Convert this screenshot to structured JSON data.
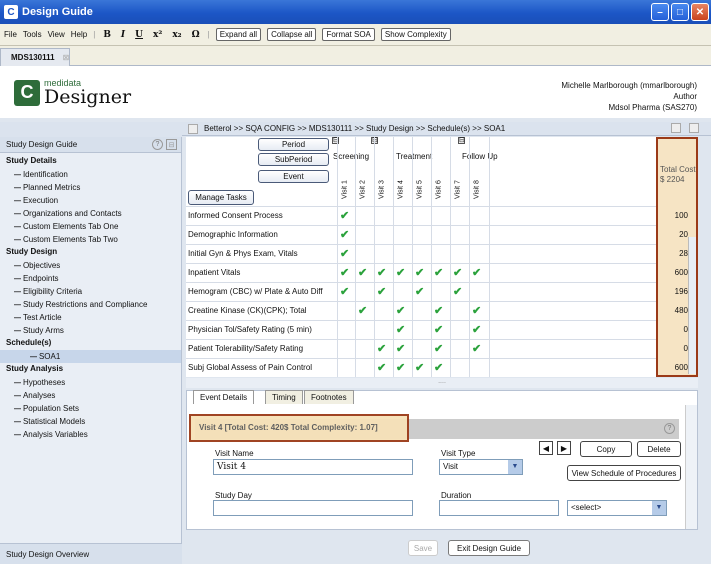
{
  "window": {
    "title": "Design Guide"
  },
  "menu": {
    "items": [
      "File",
      "Tools",
      "View",
      "Help"
    ],
    "format": [
      "B",
      "I",
      "U",
      "x²",
      "x₂",
      "Ω"
    ],
    "buttons": [
      "Expand all",
      "Collapse all",
      "Format SOA",
      "Show Complexity"
    ]
  },
  "doc_tab": "MDS130111",
  "header": {
    "logo_small": "medidata",
    "logo_big": "Designer",
    "user_line1": "Michelle Marlborough (mmarlborough)",
    "user_line2": "Author",
    "user_line3": "Mdsol Pharma (SAS270)"
  },
  "breadcrumb": "Betterol  >>  SQA CONFIG  >>  MDS130111  >>  Study Design  >>  Schedule(s)  >>  SOA1",
  "sidebar": {
    "title": "Study Design Guide",
    "footer": "Study Design Overview",
    "sections": [
      {
        "title": "Study Details",
        "items": [
          "Identification",
          "Planned Metrics",
          "Execution",
          "Organizations and Contacts",
          "Custom Elements Tab One",
          "Custom Elements Tab Two"
        ]
      },
      {
        "title": "Study Design",
        "items": [
          "Objectives",
          "Endpoints",
          "Eligibility Criteria",
          "Study Restrictions and Compliance",
          "Test Article",
          "Study Arms"
        ]
      },
      {
        "title": "Schedule(s)",
        "items": [
          "SOA1"
        ]
      },
      {
        "title": "Study Analysis",
        "items": [
          "Hypotheses",
          "Analyses",
          "Population Sets",
          "Statistical Models",
          "Analysis Variables"
        ]
      }
    ]
  },
  "grid": {
    "buttons": {
      "period": "Period",
      "subperiod": "SubPeriod",
      "event": "Event",
      "manage": "Manage Tasks"
    },
    "phases": [
      "Screening",
      "Treatment",
      "Follow Up"
    ],
    "visits": [
      "Visit 1",
      "Visit 2",
      "Visit 3",
      "Visit 4",
      "Visit 5",
      "Visit 6",
      "Visit 7",
      "Visit 8"
    ],
    "rows": [
      {
        "label": "Informed Consent Process",
        "checks": [
          1,
          0,
          0,
          0,
          0,
          0,
          0,
          0
        ],
        "cost": "100"
      },
      {
        "label": "Demographic Information",
        "checks": [
          1,
          0,
          0,
          0,
          0,
          0,
          0,
          0
        ],
        "cost": "20"
      },
      {
        "label": "Initial Gyn & Phys Exam, Vitals",
        "checks": [
          1,
          0,
          0,
          0,
          0,
          0,
          0,
          0
        ],
        "cost": "28"
      },
      {
        "label": "Inpatient Vitals",
        "checks": [
          1,
          1,
          1,
          1,
          1,
          1,
          1,
          1
        ],
        "cost": "600"
      },
      {
        "label": "Hemogram (CBC) w/ Plate & Auto Diff",
        "checks": [
          1,
          0,
          1,
          0,
          1,
          0,
          1,
          0
        ],
        "cost": "196"
      },
      {
        "label": "Creatine Kinase (CK)(CPK); Total",
        "checks": [
          0,
          1,
          0,
          1,
          0,
          1,
          0,
          1
        ],
        "cost": "480"
      },
      {
        "label": "Physician Tol/Safety Rating (5 min)",
        "checks": [
          0,
          0,
          0,
          1,
          0,
          1,
          0,
          1
        ],
        "cost": "0"
      },
      {
        "label": "Patient Tolerability/Safety Rating",
        "checks": [
          0,
          0,
          1,
          1,
          0,
          1,
          0,
          1
        ],
        "cost": "0"
      },
      {
        "label": "Subj Global Assess of Pain Control",
        "checks": [
          0,
          0,
          1,
          1,
          1,
          1,
          0,
          0
        ],
        "cost": "600"
      }
    ],
    "check_glyph": "✔",
    "cost_title": "Total Cost",
    "cost_total": "$ 2204"
  },
  "details": {
    "tabs": [
      "Event Details",
      "Timing",
      "Footnotes"
    ],
    "visit_header": "Visit 4  [Total Cost: 420$ Total Complexity: 1.07]",
    "visit_name_label": "Visit Name",
    "visit_name_value": "Visit 4",
    "visit_type_label": "Visit Type",
    "visit_type_value": "Visit",
    "study_day_label": "Study Day",
    "duration_label": "Duration",
    "duration_select": "<select>",
    "copy": "Copy",
    "delete": "Delete",
    "view_schedule": "View Schedule of Procedures"
  },
  "footer": {
    "save": "Save",
    "exit": "Exit Design Guide"
  },
  "colors": {
    "check": "#2ba23c",
    "highlight_border": "#9b3a18",
    "highlight_fill": "#f6e4c4"
  }
}
